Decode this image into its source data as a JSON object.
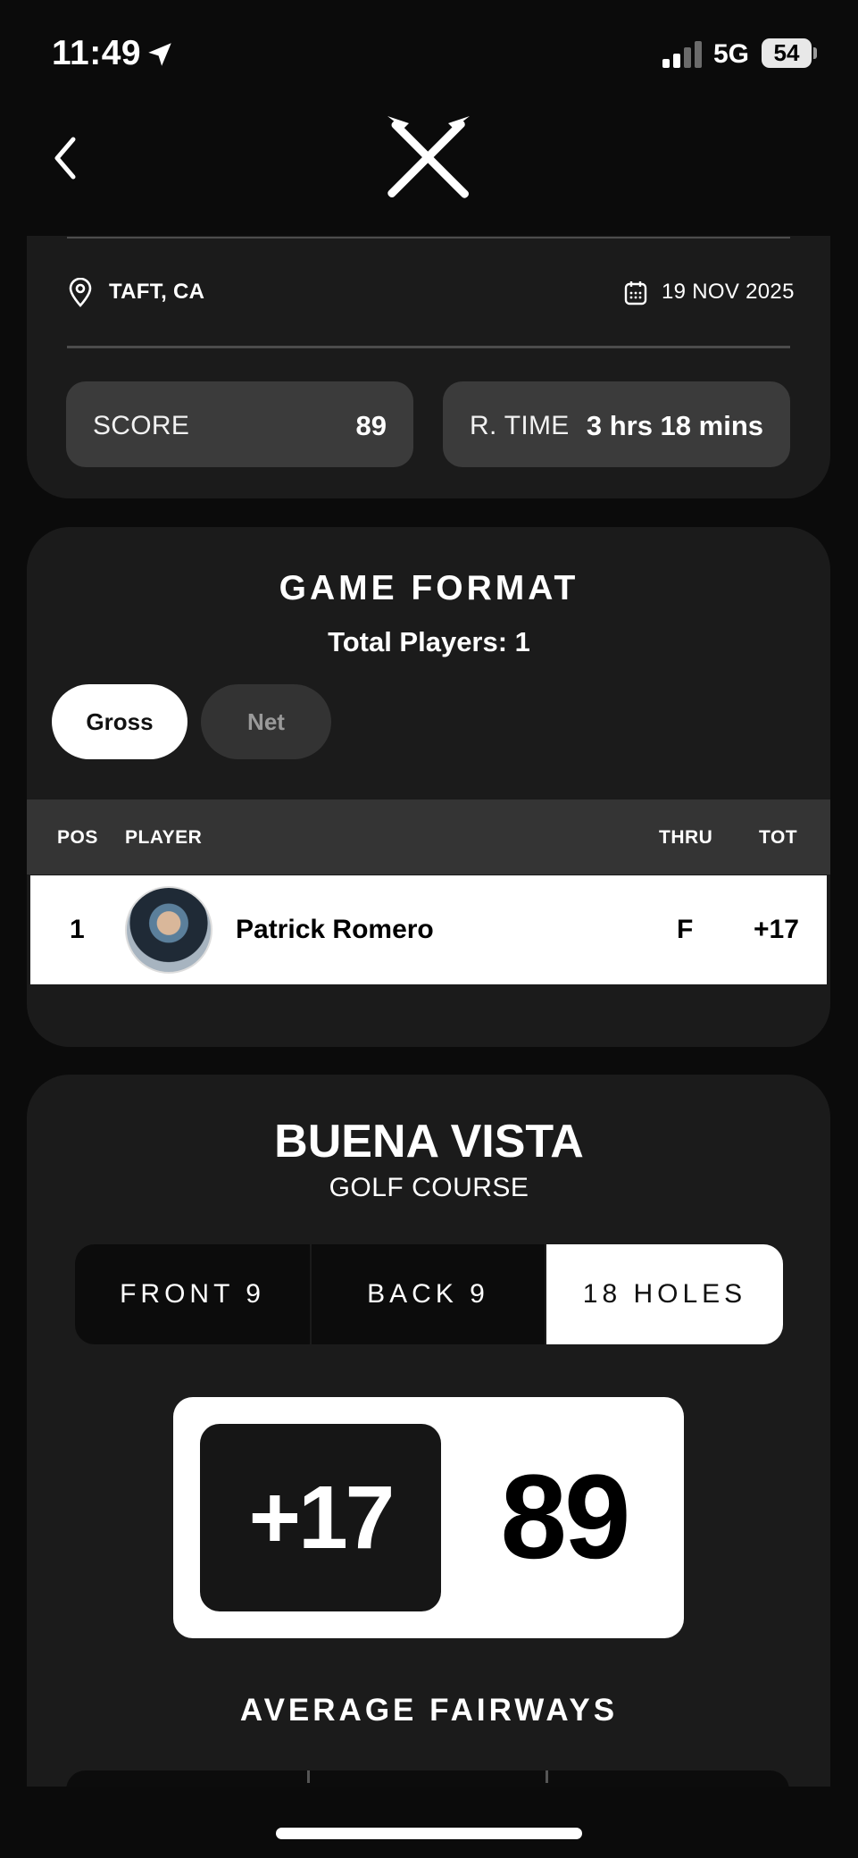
{
  "status_bar": {
    "time": "11:49",
    "network": "5G",
    "battery": "54"
  },
  "round": {
    "location": "TAFT, CA",
    "date": "19 NOV 2025",
    "score_label": "SCORE",
    "score_value": "89",
    "time_label": "R. TIME",
    "time_value": "3 hrs 18 mins"
  },
  "game_format": {
    "title": "GAME FORMAT",
    "total_players": "Total Players: 1",
    "tabs": [
      {
        "label": "Gross",
        "active": true
      },
      {
        "label": "Net",
        "active": false
      }
    ],
    "columns": {
      "pos": "POS",
      "player": "PLAYER",
      "thru": "THRU",
      "tot": "TOT"
    },
    "rows": [
      {
        "pos": "1",
        "player": "Patrick Romero",
        "thru": "F",
        "tot": "+17"
      }
    ]
  },
  "course": {
    "name": "BUENA VISTA",
    "subtitle": "GOLF COURSE",
    "segments": [
      {
        "label": "FRONT 9",
        "active": false
      },
      {
        "label": "BACK 9",
        "active": false
      },
      {
        "label": "18 HOLES",
        "active": true
      }
    ],
    "score_to_par": "+17",
    "score_total": "89",
    "stats_title": "AVERAGE FAIRWAYS"
  },
  "icons": {
    "back": "chevron-left-icon",
    "logo": "crossed-golf-tees-icon",
    "location": "map-pin-icon",
    "date": "calendar-icon"
  }
}
